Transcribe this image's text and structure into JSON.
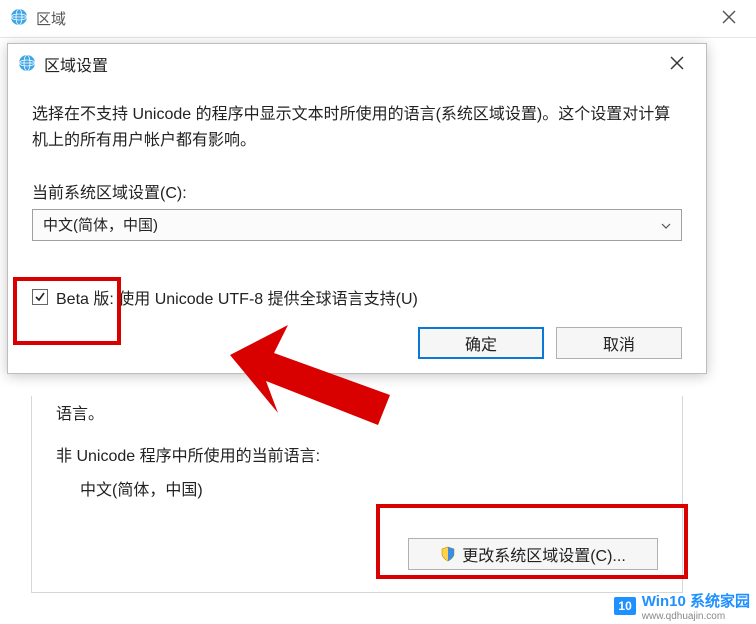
{
  "parent": {
    "title": "区域"
  },
  "dialog": {
    "title": "区域设置",
    "description": "选择在不支持 Unicode 的程序中显示文本时所使用的语言(系统区域设置)。这个设置对计算机上的所有用户帐户都有影响。",
    "locale_label": "当前系统区域设置(C):",
    "locale_value": "中文(简体，中国)",
    "beta_checked": true,
    "beta_label": "Beta 版: 使用 Unicode UTF-8 提供全球语言支持(U)",
    "ok": "确定",
    "cancel": "取消"
  },
  "back": {
    "line1": "语言。",
    "section_label": "非 Unicode 程序中所使用的当前语言:",
    "current_lang": "中文(简体，中国)",
    "change_button": "更改系统区域设置(C)..."
  },
  "watermark": {
    "badge_num": "10",
    "brand": "Win10 系统家园",
    "url": "www.qdhuajin.com"
  },
  "icons": {
    "globe": "globe-icon",
    "close": "close-icon",
    "chevron_down": "chevron-down-icon",
    "check": "check-icon",
    "shield": "shield-icon"
  }
}
